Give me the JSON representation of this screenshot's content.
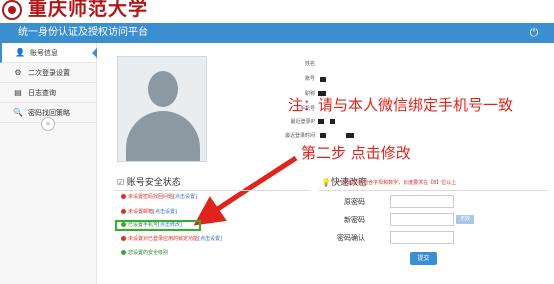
{
  "header": {
    "university_name": "重庆师范大学",
    "platform_title": "统一身份认证及授权访问平台",
    "power_icon": "power-icon"
  },
  "sidebar": {
    "items": [
      {
        "label": "账号信息",
        "icon": "user-icon",
        "active": true
      },
      {
        "label": "二次登录设置",
        "icon": "settings-icon",
        "active": false
      },
      {
        "label": "日志查询",
        "icon": "log-icon",
        "active": false
      },
      {
        "label": "密码找回策略",
        "icon": "key-icon",
        "active": false
      }
    ],
    "toggle_icon": "collapse-icon"
  },
  "profile": {
    "fields": [
      {
        "label": "姓名"
      },
      {
        "label": "账号"
      },
      {
        "label": "职称"
      },
      {
        "label": "手机号"
      },
      {
        "label": "最近登录IP"
      },
      {
        "label": "最近登录时间"
      }
    ]
  },
  "annotations": {
    "note": "注：请与本人微信绑定手机号一致",
    "step": "第二步 点击修改",
    "color": "#e0241b"
  },
  "security": {
    "title": "账号安全状态",
    "rows": [
      {
        "text": "未设置密码找回问题",
        "link": "[点击设置]",
        "status": "red"
      },
      {
        "text": "未设置邮箱",
        "link": "[点击设置]",
        "status": "red"
      },
      {
        "text": "已设置手机号",
        "link": "[点击修改]",
        "status": "green"
      },
      {
        "text": "未设置对已登录应用的锁定功能",
        "link": "[点击设置]",
        "status": "red"
      },
      {
        "text": "您设置的安全级别",
        "link": "",
        "status": "green"
      }
    ]
  },
  "quick_change": {
    "title": "快速改密",
    "hint": "* 密码必须包含字母和数字，长度要求在【8】位以上",
    "fields": [
      {
        "label": "原密码",
        "value": ""
      },
      {
        "label": "新密码",
        "value": ""
      },
      {
        "label": "密码确认",
        "value": ""
      }
    ],
    "strength_label": "无效",
    "submit_label": "提交"
  }
}
